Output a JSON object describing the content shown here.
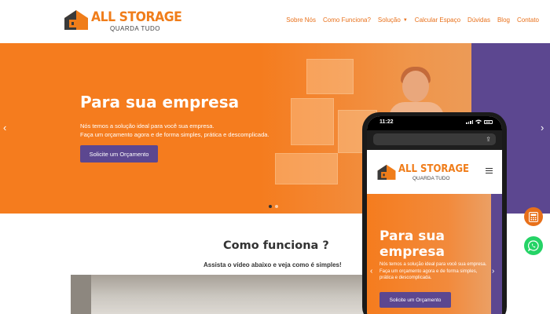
{
  "brand": {
    "name": "ALL STORAGE",
    "tagline": "QUARDA TUDO",
    "color": "#f07d1a",
    "accent": "#5c4790"
  },
  "nav": {
    "items": [
      {
        "label": "Sobre Nós"
      },
      {
        "label": "Como Funciona?"
      },
      {
        "label": "Solução",
        "has_dropdown": true
      },
      {
        "label": "Calcular Espaço"
      },
      {
        "label": "Dúvidas"
      },
      {
        "label": "Blog"
      },
      {
        "label": "Contato"
      }
    ]
  },
  "hero": {
    "title": "Para sua empresa",
    "subtitle_line1": "Nós temos a solução ideal para você sua empresa.",
    "subtitle_line2": "Faça um orçamento agora e de forma simples, prática e descomplicada.",
    "cta": "Solicite um Orçamento",
    "prev_icon": "chevron-left-icon",
    "next_icon": "chevron-right-icon",
    "slides": 2,
    "active_slide": 1
  },
  "section": {
    "title": "Como funciona ?",
    "subtitle": "Assista o vídeo abaixo e veja como é simples!"
  },
  "phone": {
    "time": "11:22",
    "brand_name": "ALL STORAGE",
    "brand_tagline": "QUARDA TUDO",
    "hero_title_line1": "Para sua",
    "hero_title_line2": "empresa",
    "hero_sub_line1": "Nós temos a solução ideal para você sua empresa.",
    "hero_sub_line2": "Faça um orçamento agora e de forma simples,",
    "hero_sub_line3": "prática e descomplicada.",
    "cta": "Solicite um Orçamento"
  },
  "floating": {
    "calculator_icon": "calculator-icon",
    "whatsapp_icon": "whatsapp-icon"
  }
}
